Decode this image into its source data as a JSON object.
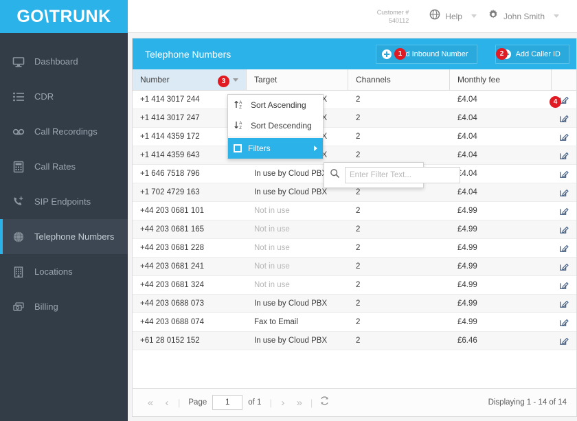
{
  "brand": {
    "logo_text": "GO\\TRUNK",
    "accent": "#2bb2e8",
    "sidebar_bg": "#333d47",
    "badge_color": "#e01b24"
  },
  "sidebar": {
    "items": [
      {
        "label": "Dashboard",
        "icon": "monitor-icon",
        "active": false
      },
      {
        "label": "CDR",
        "icon": "list-icon",
        "active": false
      },
      {
        "label": "Call Recordings",
        "icon": "voicemail-icon",
        "active": false
      },
      {
        "label": "Call Rates",
        "icon": "calculator-icon",
        "active": false
      },
      {
        "label": "SIP Endpoints",
        "icon": "phone-add-icon",
        "active": false
      },
      {
        "label": "Telephone Numbers",
        "icon": "globe-icon",
        "active": true
      },
      {
        "label": "Locations",
        "icon": "building-icon",
        "active": false
      },
      {
        "label": "Billing",
        "icon": "money-icon",
        "active": false
      }
    ]
  },
  "topbar": {
    "customer_label": "Customer #",
    "customer_number": "540112",
    "help_label": "Help",
    "help_icon": "globe-icon",
    "user_label": "John Smith",
    "user_icon": "gear-icon"
  },
  "panel": {
    "title": "Telephone Numbers",
    "buttons": [
      {
        "label": "Add Inbound Number",
        "icon": "plus-circle-icon",
        "badge": "1"
      },
      {
        "label": "Add Caller ID",
        "icon": "plus-circle-icon",
        "badge": "2"
      }
    ]
  },
  "grid": {
    "columns": [
      {
        "label": "Number",
        "selected": true,
        "has_caret": true,
        "badge": "3"
      },
      {
        "label": "Target",
        "selected": false,
        "has_caret": false
      },
      {
        "label": "Channels",
        "selected": false,
        "has_caret": false
      },
      {
        "label": "Monthly fee",
        "selected": false,
        "has_caret": false
      },
      {
        "label": "",
        "selected": false,
        "has_caret": false
      }
    ],
    "row_badge": "4",
    "rows": [
      {
        "number": "+1 414 3017 244",
        "target": "In use by Cloud PBX",
        "target_muted": false,
        "channels": "2",
        "fee": "£4.04"
      },
      {
        "number": "+1 414 3017 247",
        "target": "In use by Cloud PBX",
        "target_muted": false,
        "channels": "2",
        "fee": "£4.04"
      },
      {
        "number": "+1 414 4359 172",
        "target": "In use by Cloud PBX",
        "target_muted": false,
        "channels": "2",
        "fee": "£4.04"
      },
      {
        "number": "+1 414 4359 643",
        "target": "In use by Cloud PBX",
        "target_muted": false,
        "channels": "2",
        "fee": "£4.04"
      },
      {
        "number": "+1 646 7518 796",
        "target": "In use by Cloud PBX",
        "target_muted": false,
        "channels": "2",
        "fee": "£4.04"
      },
      {
        "number": "+1 702 4729 163",
        "target": "In use by Cloud PBX",
        "target_muted": false,
        "channels": "2",
        "fee": "£4.04"
      },
      {
        "number": "+44 203 0681 101",
        "target": "Not in use",
        "target_muted": true,
        "channels": "2",
        "fee": "£4.99"
      },
      {
        "number": "+44 203 0681 165",
        "target": "Not in use",
        "target_muted": true,
        "channels": "2",
        "fee": "£4.99"
      },
      {
        "number": "+44 203 0681 228",
        "target": "Not in use",
        "target_muted": true,
        "channels": "2",
        "fee": "£4.99"
      },
      {
        "number": "+44 203 0681 241",
        "target": "Not in use",
        "target_muted": true,
        "channels": "2",
        "fee": "£4.99"
      },
      {
        "number": "+44 203 0681 324",
        "target": "Not in use",
        "target_muted": true,
        "channels": "2",
        "fee": "£4.99"
      },
      {
        "number": "+44 203 0688 073",
        "target": "In use by Cloud PBX",
        "target_muted": false,
        "channels": "2",
        "fee": "£4.99"
      },
      {
        "number": "+44 203 0688 074",
        "target": "Fax to Email",
        "target_muted": false,
        "channels": "2",
        "fee": "£4.99"
      },
      {
        "number": "+61 28 0152 152",
        "target": "In use by Cloud PBX",
        "target_muted": false,
        "channels": "2",
        "fee": "£6.46"
      }
    ]
  },
  "menu": {
    "sort_ascending": "Sort Ascending",
    "sort_descending": "Sort Descending",
    "filters": "Filters",
    "filter_placeholder": "Enter Filter Text...",
    "filter_value": "",
    "filter_search_icon": "search-icon"
  },
  "pager": {
    "first_icon": "«",
    "prev_icon": "‹",
    "next_icon": "›",
    "last_icon": "»",
    "page_label": "Page",
    "page_value": "1",
    "of_label": "of 1",
    "refresh_icon": "refresh-icon",
    "displaying": "Displaying 1 - 14 of 14"
  }
}
